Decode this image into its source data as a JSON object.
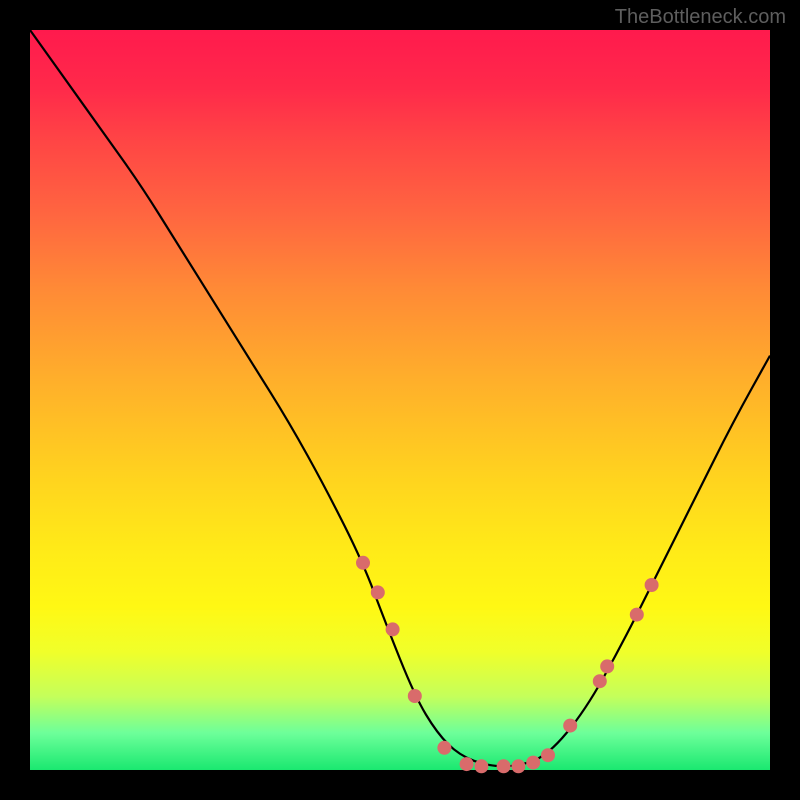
{
  "watermark": "TheBottleneck.com",
  "chart_data": {
    "type": "line",
    "title": "",
    "xlabel": "",
    "ylabel": "",
    "xlim": [
      0,
      100
    ],
    "ylim": [
      0,
      100
    ],
    "grid": false,
    "legend": false,
    "series": [
      {
        "name": "curve",
        "color": "#000000",
        "x": [
          0,
          5,
          10,
          15,
          20,
          25,
          30,
          35,
          40,
          45,
          48,
          52,
          55,
          58,
          62,
          66,
          70,
          75,
          80,
          85,
          90,
          95,
          100
        ],
        "y": [
          100,
          93,
          86,
          79,
          71,
          63,
          55,
          47,
          38,
          28,
          20,
          10,
          5,
          2,
          0.5,
          0.5,
          2,
          8,
          17,
          27,
          37,
          47,
          56
        ]
      }
    ],
    "markers": {
      "name": "dots",
      "color": "#d96b6b",
      "x": [
        45,
        47,
        49,
        52,
        56,
        59,
        61,
        64,
        66,
        68,
        70,
        73,
        77,
        78,
        82,
        84
      ],
      "y": [
        28,
        24,
        19,
        10,
        3,
        0.8,
        0.5,
        0.5,
        0.5,
        1,
        2,
        6,
        12,
        14,
        21,
        25
      ]
    }
  },
  "colors": {
    "background": "#000000",
    "curve": "#000000",
    "dots": "#d96b6b"
  }
}
